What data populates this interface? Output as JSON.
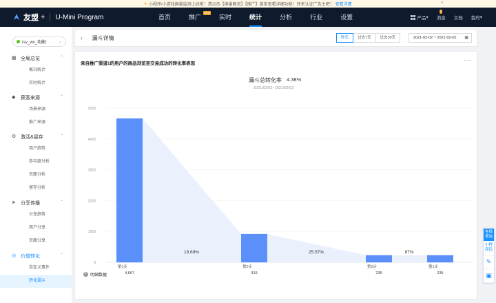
{
  "notice": {
    "text": "小程序/小游戏换量监测上线啦！请点击【换量概况】【推广】菜单查看详细功能！快来认证广告主吧！",
    "link": "查看详情"
  },
  "brand": {
    "name": "友盟",
    "plus": "+",
    "product": "U-Mini Program"
  },
  "nav": {
    "items": [
      {
        "label": "首页"
      },
      {
        "label": "推广",
        "badge": "NEW"
      },
      {
        "label": "实时"
      },
      {
        "label": "统计",
        "active": true
      },
      {
        "label": "分析"
      },
      {
        "label": "行业"
      },
      {
        "label": "设置"
      }
    ],
    "right": {
      "products": "产品",
      "messages": "消息",
      "msg_count": "2",
      "docs": "文档",
      "mine": "我的"
    }
  },
  "sidebar": {
    "app_selector": "rsv_wx_功能!",
    "groups": [
      {
        "title": "全局总览",
        "icon": "dashboard-icon",
        "items": [
          "概况统计",
          "实时统计"
        ]
      },
      {
        "title": "获客来源",
        "icon": "source-icon",
        "items": [
          "场景来源",
          "推广来源"
        ]
      },
      {
        "title": "激活&留存",
        "icon": "retention-icon",
        "items": [
          "用户趋势",
          "参与度分析",
          "页面分析",
          "留存分析"
        ]
      },
      {
        "title": "分享传播",
        "icon": "share-icon",
        "items": [
          "分享趋势",
          "用户分享",
          "页面分享"
        ]
      },
      {
        "title": "价值转化",
        "icon": "conversion-icon",
        "items": [
          "自定义事件",
          "转化漏斗"
        ],
        "active": true,
        "active_item": "转化漏斗"
      }
    ]
  },
  "header": {
    "back_icon": "chevron-left-icon",
    "title": "漏斗详情",
    "ranges": [
      "昨天",
      "过去7天",
      "过去30天"
    ],
    "active_range": "昨天",
    "date_range": "2021-02-02 ~ 2021-02-02"
  },
  "card": {
    "title": "来自推广渠道1的用户的商品浏览至交易成功的转化率表现",
    "funnel_title": "漏斗总转化率",
    "funnel_rate": "4.38%",
    "funnel_date": "2021/02/02~2021/02/02",
    "detail_label": "明细数据"
  },
  "chart_data": {
    "type": "bar",
    "categories": [
      "第1步",
      "第2步",
      "第3步",
      "第1步"
    ],
    "sub_labels": [
      "",
      "",
      "",
      ""
    ],
    "values": [
      4667,
      919,
      235,
      235
    ],
    "value_labels": [
      "4,667",
      "919",
      "235",
      "235"
    ],
    "conversion_rates": [
      "19.69%",
      "25.57%",
      "87%"
    ],
    "ylim": [
      0,
      5000
    ],
    "yticks": [
      0,
      1000,
      2000,
      3000,
      4000,
      5000
    ],
    "grid": true,
    "bar_color": "#5b8ff9",
    "funnel_color": "#eaf1fd"
  },
  "float": {
    "consult": "在线咨询",
    "program": "小程序码"
  }
}
